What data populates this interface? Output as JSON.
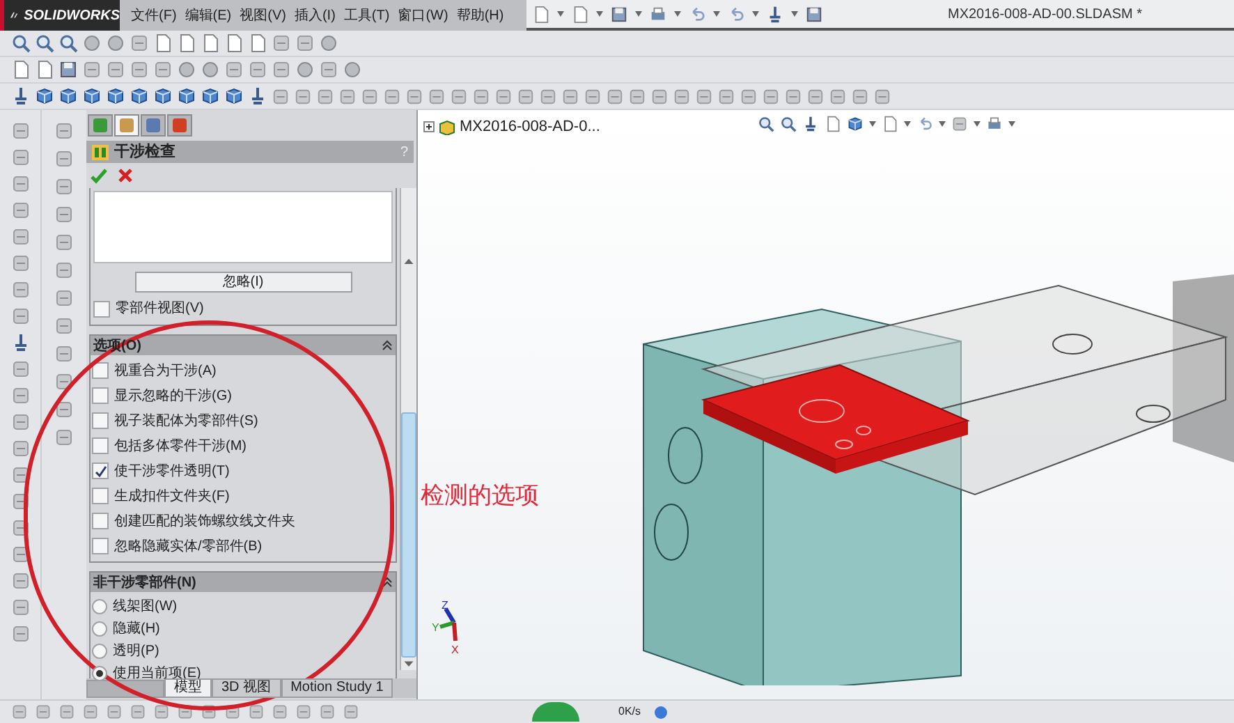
{
  "title_bar": {
    "logo": "SOLIDWORKS",
    "menus": [
      "文件(F)",
      "编辑(E)",
      "视图(V)",
      "插入(I)",
      "工具(T)",
      "窗口(W)",
      "帮助(H)"
    ],
    "document_title": "MX2016-008-AD-00.SLDASM *"
  },
  "property_panel": {
    "tabs": [
      {
        "selected": false
      },
      {
        "selected": true
      },
      {
        "selected": false
      },
      {
        "selected": false
      }
    ],
    "title": "干涉检查",
    "help": "?",
    "ignore_button": "忽略(I)",
    "component_view": {
      "label": "零部件视图(V)",
      "checked": false
    },
    "options": {
      "title": "选项(O)",
      "expanded": true,
      "items": [
        {
          "label": "视重合为干涉(A)",
          "checked": false
        },
        {
          "label": "显示忽略的干涉(G)",
          "checked": false
        },
        {
          "label": "视子装配体为零部件(S)",
          "checked": false
        },
        {
          "label": "包括多体零件干涉(M)",
          "checked": false
        },
        {
          "label": "使干涉零件透明(T)",
          "checked": true
        },
        {
          "label": "生成扣件文件夹(F)",
          "checked": false
        },
        {
          "label": "创建匹配的装饰螺纹线文件夹",
          "checked": false
        },
        {
          "label": "忽略隐藏实体/零部件(B)",
          "checked": false
        }
      ]
    },
    "non_interfering": {
      "title": "非干涉零部件(N)",
      "expanded": true,
      "items": [
        {
          "label": "线架图(W)",
          "selected": false
        },
        {
          "label": "隐藏(H)",
          "selected": false
        },
        {
          "label": "透明(P)",
          "selected": false
        },
        {
          "label": "使用当前项(E)",
          "selected": true
        }
      ]
    },
    "bottom_tabs": [
      {
        "label": "模型",
        "selected": true
      },
      {
        "label": "3D 视图",
        "selected": false
      },
      {
        "label": "Motion Study 1",
        "selected": false
      }
    ]
  },
  "feature_tree": {
    "root": "MX2016-008-AD-0..."
  },
  "annotation": {
    "text": "检测的选项"
  },
  "triad": {
    "labels": [
      "Z",
      "Y",
      "X"
    ]
  },
  "status_bar": {
    "speed": "0K/s"
  }
}
